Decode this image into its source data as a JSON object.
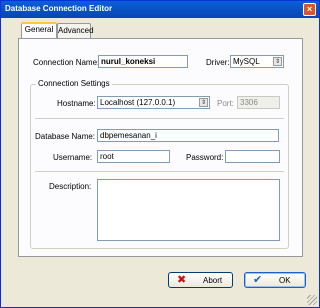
{
  "window": {
    "title": "Database Connection Editor",
    "close_glyph": "×"
  },
  "tabs": [
    {
      "label": "General"
    },
    {
      "label": "Advanced"
    }
  ],
  "form": {
    "connection_name_label": "Connection Name:",
    "connection_name_value": "nurul_koneksi",
    "driver_label": "Driver:",
    "driver_value": "MySQL",
    "settings_group_title": "Connection Settings",
    "hostname_label": "Hostname:",
    "hostname_value": "Localhost (127.0.0.1)",
    "port_label": "Port:",
    "port_value": "3306",
    "database_name_label": "Database Name:",
    "database_name_value": "dbpemesanan_i",
    "username_label": "Username:",
    "username_value": "root",
    "password_label": "Password:",
    "password_value": "",
    "description_label": "Description:",
    "description_value": ""
  },
  "buttons": {
    "abort_label": "Abort",
    "ok_label": "OK"
  },
  "icons": {
    "combo_arrow": "⇕",
    "abort_icon": "✖",
    "ok_icon": "✔"
  },
  "colors": {
    "abort_icon": "#cc1111",
    "ok_icon": "#1e5fc4",
    "titlebar": "#0a5fd8"
  }
}
